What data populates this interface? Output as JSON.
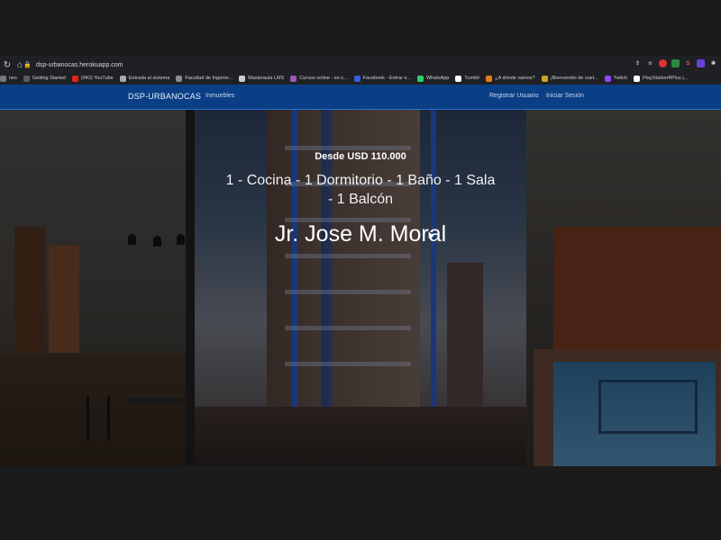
{
  "browser": {
    "url": "dsp-urbanocas.herokuapp.com",
    "bookmarks": [
      {
        "label": "nes",
        "color": "#7a7a7a"
      },
      {
        "label": "Getting Started",
        "color": "#5a5a5a"
      },
      {
        "label": "(942) YouTube",
        "color": "#e62117"
      },
      {
        "label": "Entrada al sistema",
        "color": "#aaaaaa"
      },
      {
        "label": "Facultad de Ingenie...",
        "color": "#8c8c8c"
      },
      {
        "label": "Masteraula LMS",
        "color": "#cccccc"
      },
      {
        "label": "Cursos online - ex-c...",
        "color": "#9b59b6"
      },
      {
        "label": "Facebook - Entrar o...",
        "color": "#3b5bdb"
      },
      {
        "label": "WhatsApp",
        "color": "#25d366"
      },
      {
        "label": "Tumblr",
        "color": "#ffffff"
      },
      {
        "label": "¿A dónde vamos?",
        "color": "#e67e22"
      },
      {
        "label": "¡Bienvenido de vuel...",
        "color": "#c9a227"
      },
      {
        "label": "Twitch",
        "color": "#9146ff"
      },
      {
        "label": "PlayStation®Plus |...",
        "color": "#ffffff"
      }
    ],
    "extensions": [
      {
        "label": "",
        "color": "#e03131"
      },
      {
        "label": "",
        "color": "#2b8a3e"
      },
      {
        "label": "S",
        "color": "#c92a2a"
      },
      {
        "label": "",
        "color": "#6741d9"
      },
      {
        "label": "",
        "color": "#868e96"
      }
    ]
  },
  "navbar": {
    "brand": "DSP-URBANOCAS",
    "links": [
      "Inmuebles"
    ],
    "right_links": [
      "Registrar Usuario",
      "Iniciar Sesión"
    ]
  },
  "hero": {
    "price": "Desde USD 110.000",
    "features": "1 - Cocina - 1 Dormitorio - 1 Baño - 1 Sala - 1 Balcón",
    "title": "Jr. Jose M. Moral"
  }
}
